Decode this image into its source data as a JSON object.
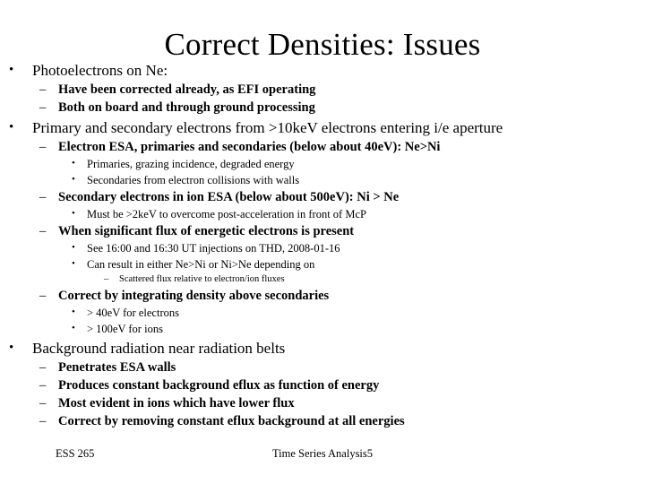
{
  "slide": {
    "title": "Correct Densities: Issues",
    "background_color": "#ffffff",
    "text_color": "#000000",
    "markers": {
      "level1": "•",
      "level2": "–",
      "level3": "•",
      "level4": "–"
    },
    "outline": [
      {
        "level": 1,
        "text": "Photoelectrons on Ne:"
      },
      {
        "level": 2,
        "text": "Have been corrected already, as EFI operating"
      },
      {
        "level": 2,
        "text": "Both on board and through ground processing"
      },
      {
        "level": 1,
        "text": "Primary and secondary electrons from >10keV electrons entering i/e aperture"
      },
      {
        "level": 2,
        "text": "Electron ESA, primaries and secondaries (below about 40eV): Ne>Ni"
      },
      {
        "level": 3,
        "text": "Primaries, grazing incidence, degraded energy"
      },
      {
        "level": 3,
        "text": "Secondaries from electron collisions with walls"
      },
      {
        "level": 2,
        "text": "Secondary electrons in ion ESA (below about 500eV): Ni > Ne"
      },
      {
        "level": 3,
        "text": "Must be >2keV to overcome post-acceleration in front of McP"
      },
      {
        "level": 2,
        "text": "When significant flux of energetic electrons is present"
      },
      {
        "level": 3,
        "text": "See 16:00 and 16:30 UT injections on THD, 2008-01-16"
      },
      {
        "level": 3,
        "text": "Can result in either Ne>Ni or Ni>Ne depending on"
      },
      {
        "level": 4,
        "text": "Scattered flux relative to electron/ion fluxes"
      },
      {
        "level": 2,
        "text": "Correct by integrating density above secondaries"
      },
      {
        "level": 3,
        "text": "> 40eV for electrons"
      },
      {
        "level": 3,
        "text": "> 100eV for ions"
      },
      {
        "level": 1,
        "text": "Background radiation near radiation belts"
      },
      {
        "level": 2,
        "text": "Penetrates ESA walls"
      },
      {
        "level": 2,
        "text": "Produces constant background eflux as function of energy"
      },
      {
        "level": 2,
        "text": "Most evident in ions which have lower flux"
      },
      {
        "level": 2,
        "text": "Correct by removing constant eflux background at all energies"
      }
    ],
    "footer": {
      "left": "ESS 265",
      "center": "Time Series Analysis5"
    }
  }
}
